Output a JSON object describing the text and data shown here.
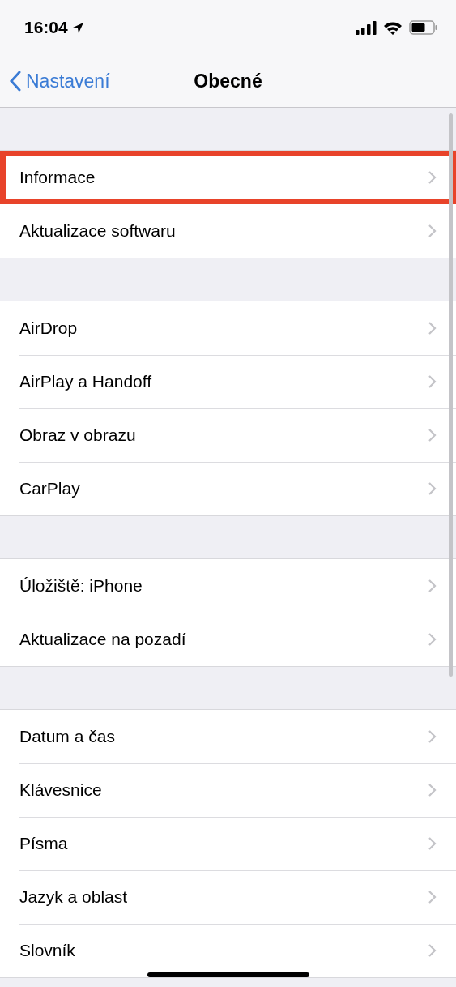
{
  "status_bar": {
    "time": "16:04"
  },
  "nav": {
    "back": "Nastavení",
    "title": "Obecné"
  },
  "groups": [
    {
      "items": [
        {
          "label": "Informace",
          "highlighted": true
        },
        {
          "label": "Aktualizace softwaru",
          "highlighted": false
        }
      ]
    },
    {
      "items": [
        {
          "label": "AirDrop",
          "highlighted": false
        },
        {
          "label": "AirPlay a Handoff",
          "highlighted": false
        },
        {
          "label": "Obraz v obrazu",
          "highlighted": false
        },
        {
          "label": "CarPlay",
          "highlighted": false
        }
      ]
    },
    {
      "items": [
        {
          "label": "Úložiště: iPhone",
          "highlighted": false
        },
        {
          "label": "Aktualizace na pozadí",
          "highlighted": false
        }
      ]
    },
    {
      "items": [
        {
          "label": "Datum a čas",
          "highlighted": false
        },
        {
          "label": "Klávesnice",
          "highlighted": false
        },
        {
          "label": "Písma",
          "highlighted": false
        },
        {
          "label": "Jazyk a oblast",
          "highlighted": false
        },
        {
          "label": "Slovník",
          "highlighted": false
        }
      ]
    }
  ]
}
